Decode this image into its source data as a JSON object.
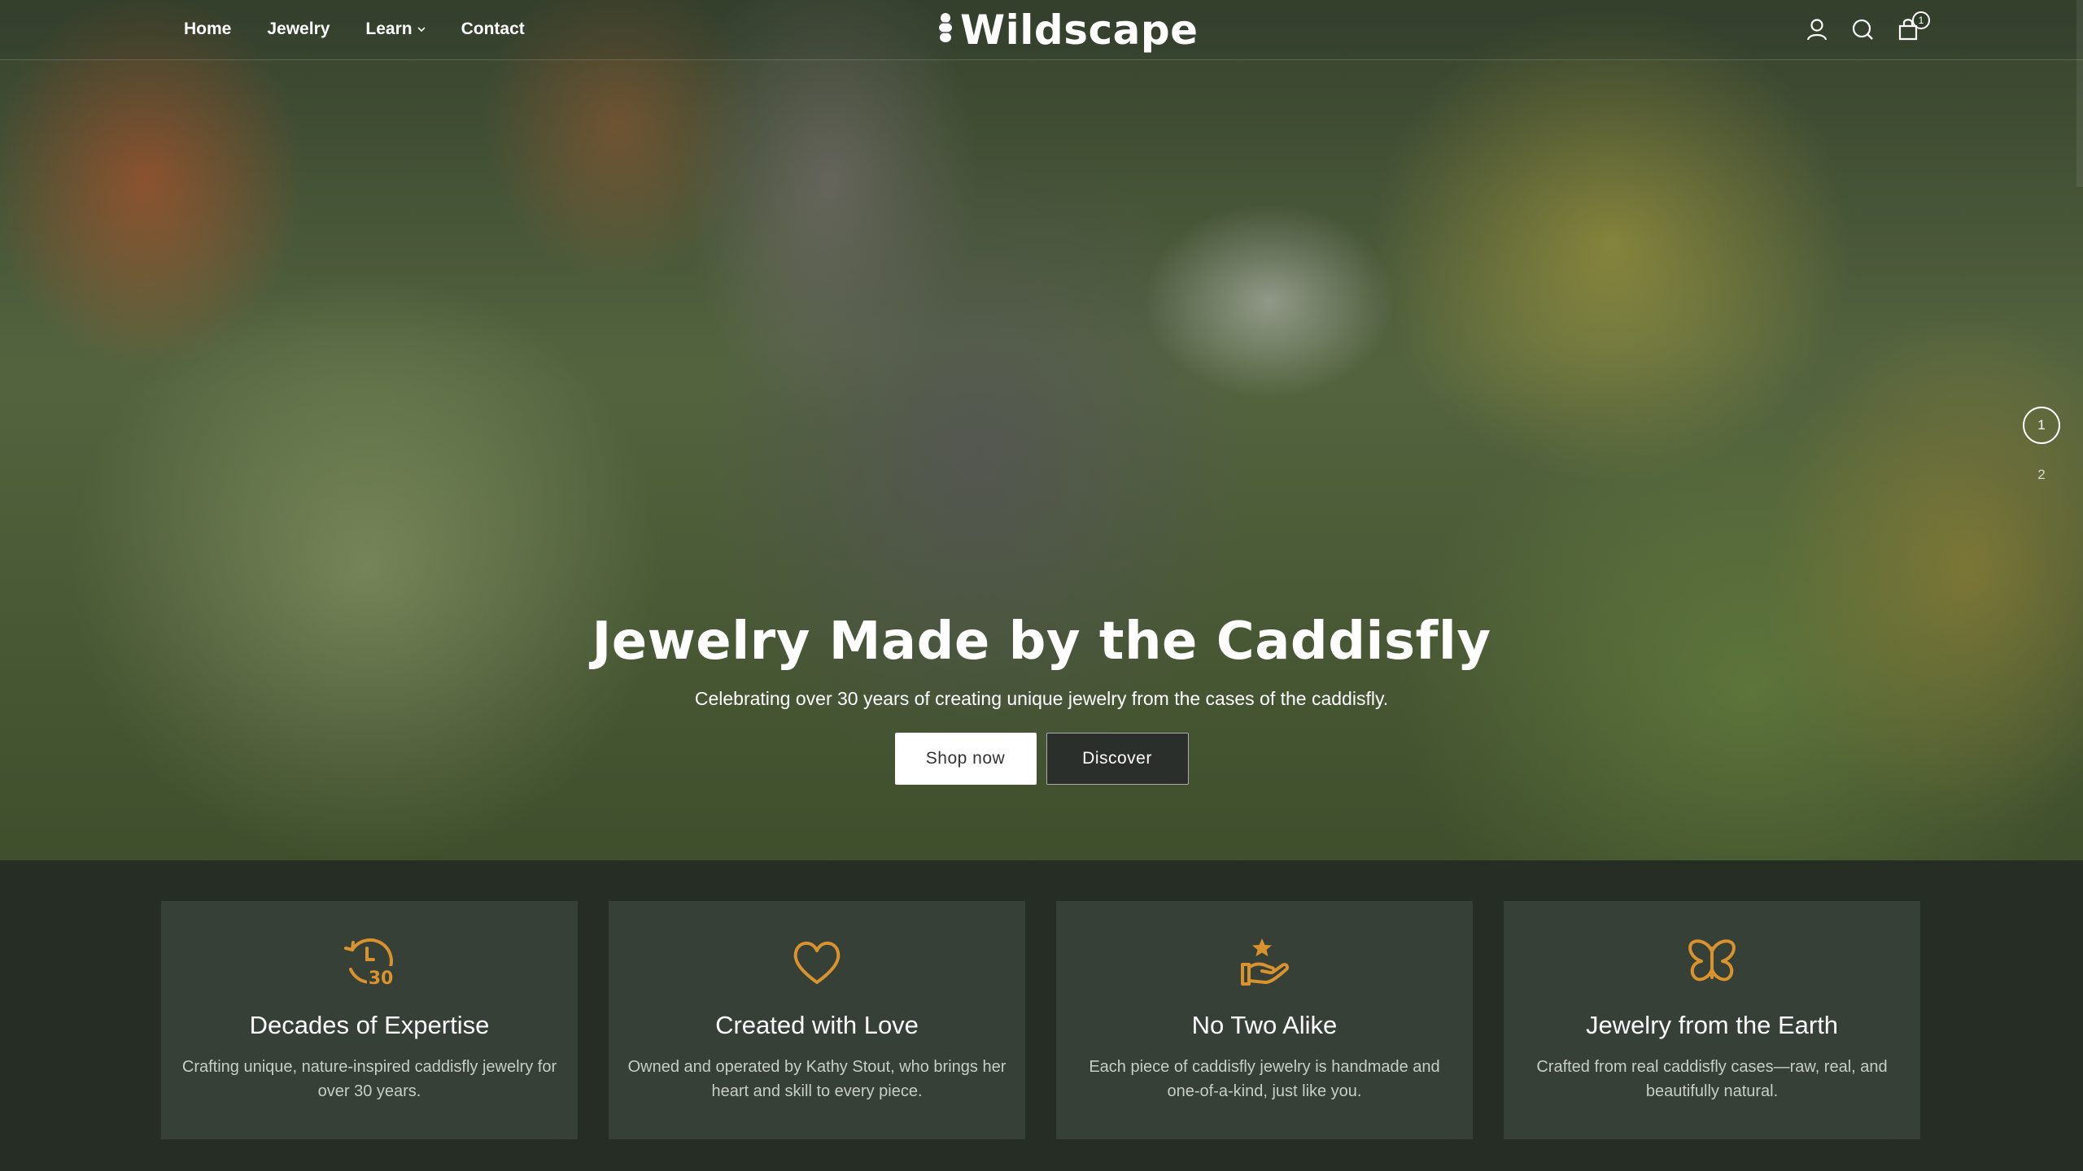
{
  "nav": {
    "links": [
      {
        "label": "Home"
      },
      {
        "label": "Jewelry"
      },
      {
        "label": "Learn"
      },
      {
        "label": "Contact"
      }
    ],
    "logo": "Wildscape",
    "cart_count": "1",
    "icons": [
      "account-icon",
      "search-icon",
      "cart-icon"
    ]
  },
  "hero": {
    "title": "Jewelry Made by the Caddisfly",
    "subtitle": "Celebrating over 30 years of creating unique jewelry from the cases of the caddisfly.",
    "primary_button": "Shop now",
    "secondary_button": "Discover",
    "slides": [
      "1",
      "2"
    ],
    "active_slide": "1"
  },
  "features": [
    {
      "icon": "thirty-years-icon",
      "title": "Decades of Expertise",
      "text": "Crafting unique, nature-inspired caddisfly jewelry for over 30 years.",
      "icon_text": "30"
    },
    {
      "icon": "heart-icon",
      "title": "Created with Love",
      "text": "Owned and operated by Kathy Stout, who brings her heart and skill to every piece."
    },
    {
      "icon": "hand-star-icon",
      "title": "No Two Alike",
      "text": "Each piece of caddisfly jewelry is handmade and one-of-a-kind, just like you."
    },
    {
      "icon": "butterfly-icon",
      "title": "Jewelry from the Earth",
      "text": "Crafted from real caddisfly cases—raw, real, and beautifully natural."
    }
  ],
  "colors": {
    "accent": "#d8922e",
    "card_bg": "#364036",
    "page_bg": "#252d25"
  }
}
